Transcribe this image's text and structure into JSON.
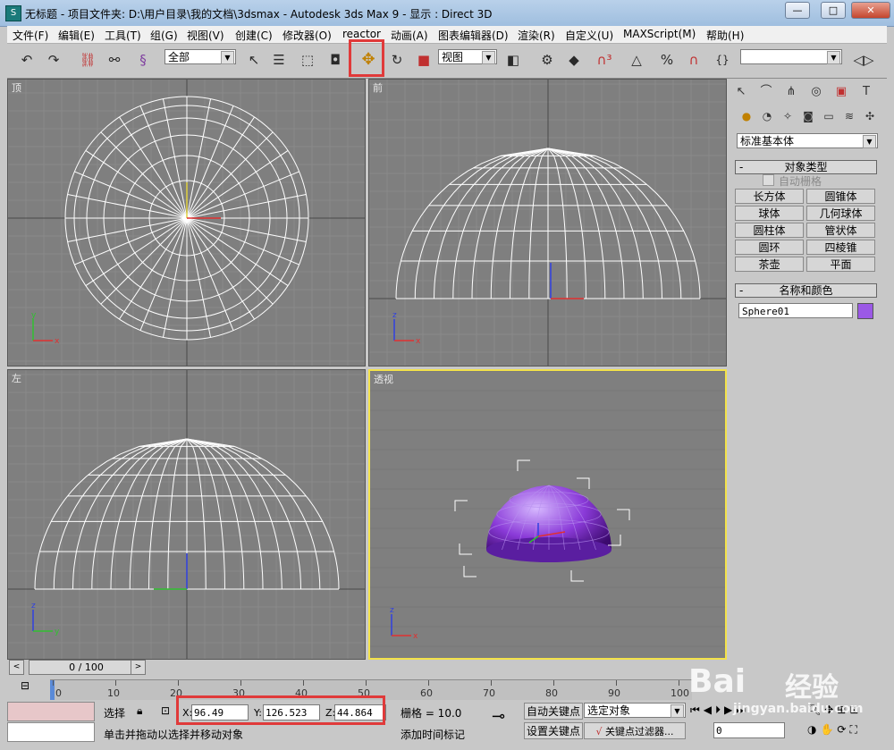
{
  "window": {
    "title": "无标题     - 项目文件夹: D:\\用户目录\\我的文档\\3dsmax     - Autodesk 3ds Max 9     - 显示 : Direct 3D",
    "minimize": "—",
    "maximize": "□",
    "close": "✕"
  },
  "menu": [
    "文件(F)",
    "编辑(E)",
    "工具(T)",
    "组(G)",
    "视图(V)",
    "创建(C)",
    "修改器(O)",
    "reactor",
    "动画(A)",
    "图表编辑器(D)",
    "渲染(R)",
    "自定义(U)",
    "MAXScript(M)",
    "帮助(H)"
  ],
  "toolbar": {
    "selection_filter": "全部",
    "reference_coord": "视图",
    "named_selection": ""
  },
  "viewports": {
    "top": "顶",
    "front": "前",
    "left": "左",
    "perspective": "透视"
  },
  "command_panel": {
    "category": "标准基本体",
    "object_type_title": "对象类型",
    "auto_grid": "自动栅格",
    "objects": [
      "长方体",
      "圆锥体",
      "球体",
      "几何球体",
      "圆柱体",
      "管状体",
      "圆环",
      "四棱锥",
      "茶壶",
      "平面"
    ],
    "name_color_title": "名称和颜色",
    "object_name": "Sphere01",
    "object_color": "#9b59e6"
  },
  "timeline": {
    "frame": "0 / 100",
    "ticks": [
      "0",
      "10",
      "20",
      "30",
      "40",
      "50",
      "60",
      "70",
      "80",
      "90",
      "100"
    ]
  },
  "status": {
    "selection": "选择",
    "x_label": "X:",
    "x_value": "96.49",
    "y_label": "Y:",
    "y_value": "126.523",
    "z_label": "Z:",
    "z_value": "44.864",
    "grid": "栅格 = 10.0",
    "prompt": "单击并拖动以选择并移动对象",
    "add_time_tag": "添加时间标记",
    "auto_key": "自动关键点",
    "set_key": "设置关键点",
    "key_filter": "关键点过滤器...",
    "selected": "选定对象",
    "frame_value": "0"
  },
  "watermark": {
    "brand": "Bai",
    "site": "jingyan.baidu.com",
    "label": "经验"
  }
}
